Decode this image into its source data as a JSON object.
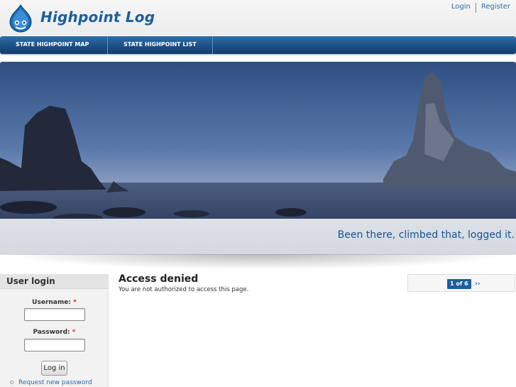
{
  "site": {
    "name": "Highpoint Log",
    "logo_icon": "drupal-drop-icon"
  },
  "user_links": {
    "login": "Login",
    "register": "Register"
  },
  "nav": {
    "items": [
      {
        "label": "STATE HIGHPOINT MAP"
      },
      {
        "label": "STATE HIGHPOINT LIST"
      }
    ]
  },
  "banner": {
    "slogan": "Been there, climbed that, logged it."
  },
  "sidebar": {
    "block_title": "User login",
    "username_label": "Username:",
    "password_label": "Password:",
    "required_marker": "*",
    "username_value": "",
    "password_value": "",
    "login_button": "Log in",
    "request_password": "Request new password"
  },
  "main": {
    "title": "Access denied",
    "message": "You are not authorized to access this page."
  },
  "pager": {
    "count": "1 of 6",
    "next": "››"
  },
  "colors": {
    "brand": "#1b5f9e",
    "nav_bg": "#1b4f85",
    "link": "#2a6aa6"
  }
}
